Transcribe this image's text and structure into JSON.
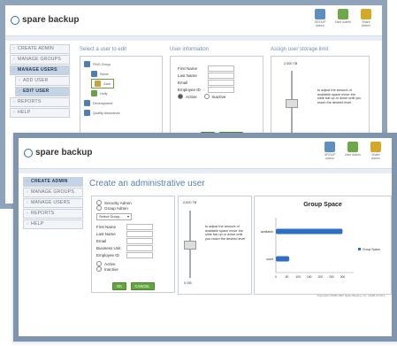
{
  "app": {
    "logo_text": "spare backup"
  },
  "header_icons": [
    {
      "name": "group-admin-icon",
      "label": "GROUP Admin"
    },
    {
      "name": "user-admin-icon",
      "label": "User Admin"
    },
    {
      "name": "share-admin-icon",
      "label": "Share Admin"
    }
  ],
  "back_window": {
    "sidebar": [
      {
        "label": "CREATE ADMIN",
        "level": 0,
        "active": false
      },
      {
        "label": "MANAGE GROUPS",
        "level": 0,
        "active": false
      },
      {
        "label": "MANAGE USERS",
        "level": 0,
        "active": true
      },
      {
        "label": "ADD USER",
        "level": 1,
        "active": false
      },
      {
        "label": "EDIT USER",
        "level": 1,
        "active": true
      },
      {
        "label": "REPORTS",
        "level": 0,
        "active": false
      },
      {
        "label": "HELP",
        "level": 0,
        "active": false
      }
    ],
    "select_user_title": "Select a user to edit",
    "user_info_title": "User information",
    "storage_title": "Assign user storage limit",
    "tree": [
      {
        "label": "PMG Group",
        "icon": "group"
      },
      {
        "label": "Steve",
        "icon": "user"
      },
      {
        "label": "Zack",
        "icon": "user",
        "selected": true
      },
      {
        "label": "Holly",
        "icon": "user"
      },
      {
        "label": "Development",
        "icon": "group"
      },
      {
        "label": "Quality Assurance",
        "icon": "group"
      }
    ],
    "fields": [
      "First Name",
      "Last Name",
      "Email",
      "Employee ID"
    ],
    "status_active": "Active",
    "status_inactive": "Inactive",
    "ok": "OK",
    "cancel": "CANCEL",
    "slider_top": "2,000 TB",
    "slider_bottom": "0 GB",
    "slider_help": "to adjust the amount of available space move the slide bar up or down until you reach the desired level"
  },
  "front_window": {
    "sidebar": [
      {
        "label": "CREATE ADMIN",
        "level": 0,
        "active": true
      },
      {
        "label": "MANAGE GROUPS",
        "level": 0,
        "active": false
      },
      {
        "label": "MANAGE USERS",
        "level": 0,
        "active": false
      },
      {
        "label": "REPORTS",
        "level": 0,
        "active": false
      },
      {
        "label": "HELP",
        "level": 0,
        "active": false
      }
    ],
    "page_title": "Create an administrative user",
    "radio_security": "Security Admin",
    "radio_group": "Group Admin",
    "select_group": "Select Group...",
    "fields": [
      "First Name",
      "Last Name",
      "Email",
      "Business Unit",
      "Employee ID"
    ],
    "status_active": "Active",
    "status_inactive": "Inactive",
    "ok": "OK",
    "cancel": "CANCEL",
    "slider_top": "2,000 TB",
    "slider_bottom": "0 GB",
    "slider_help": "to adjust the amount of available space move the slide bar up or down until you reach the desired level",
    "copyright": "Copyright ©2006-2007 Spare Backup, Inc. | 2006 13.09.3"
  },
  "chart_data": {
    "type": "bar",
    "title": "Group Space",
    "categories": [
      "available",
      "used"
    ],
    "values": [
      300,
      60
    ],
    "xticks": [
      "0",
      "50",
      "100",
      "150",
      "200",
      "250",
      "300"
    ],
    "xlim": [
      0,
      350
    ],
    "legend": "Group Space",
    "color": "#2d6fc2"
  }
}
